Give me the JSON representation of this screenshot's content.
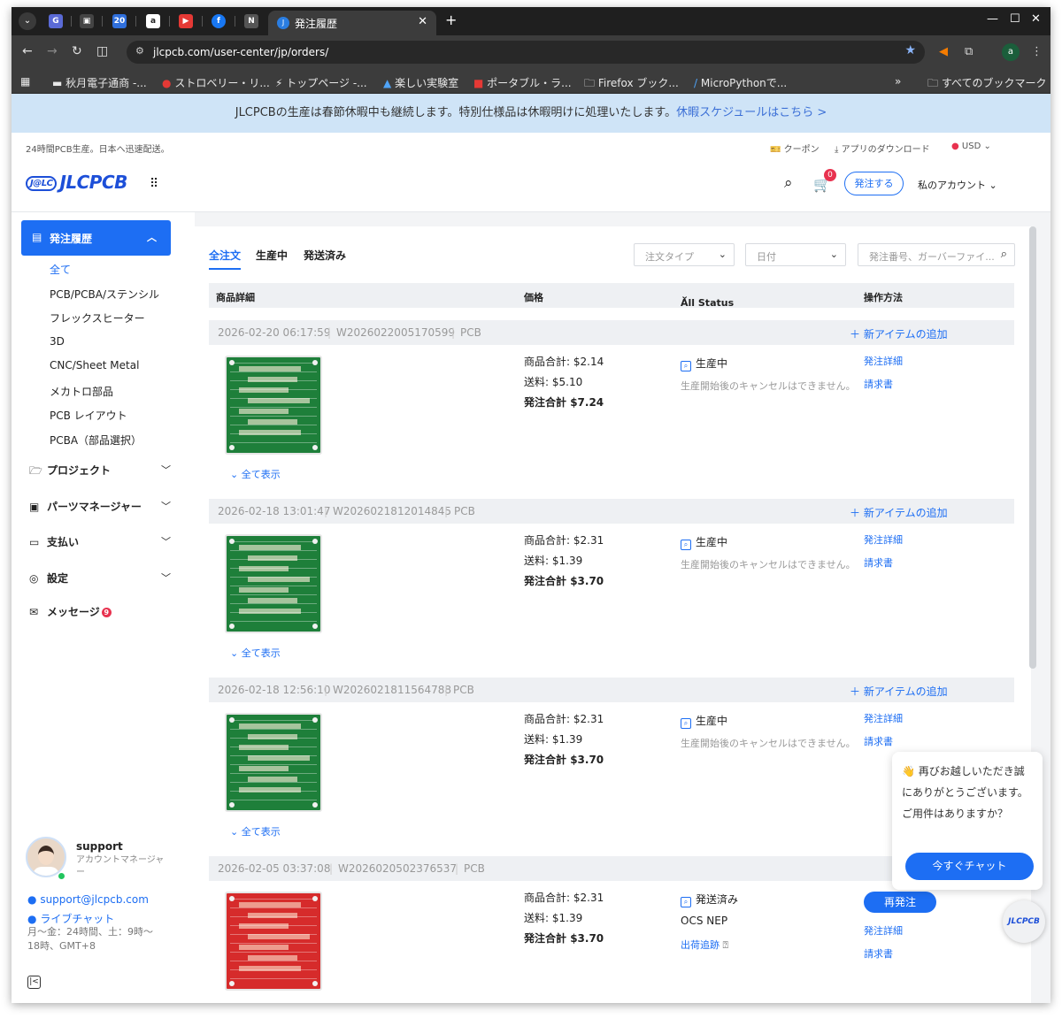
{
  "browser": {
    "tab_title": "発注履歴",
    "url": "jlcpcb.com/user-center/jp/orders/",
    "pinned_tabs": [
      {
        "name": "gemini-tab",
        "label": "G",
        "color": "#5a6ad6"
      },
      {
        "name": "box-tab",
        "label": "▣",
        "color": "#444"
      },
      {
        "name": "calendar-tab",
        "label": "20",
        "color": "#2f6fdc"
      },
      {
        "name": "amazon-tab",
        "label": "a",
        "color": "#222"
      },
      {
        "name": "youtube-tab",
        "label": "▶",
        "color": "#e53935"
      },
      {
        "name": "facebook-tab",
        "label": "f",
        "color": "#1877f2"
      },
      {
        "name": "notion-tab",
        "label": "N",
        "color": "#555"
      }
    ],
    "bookmarks": [
      "秋月電子通商 -...",
      "ストロベリー・リ...",
      "トップページ -...",
      "楽しい実験室",
      "ポータブル・ラ...",
      "Firefox ブック...",
      "MicroPythonで...",
      "すべてのブックマーク"
    ],
    "profile_initial": "a"
  },
  "banner": {
    "text": "JLCPCBの生産は春節休暇中も継続します。特別仕様品は休暇明けに処理いたします。",
    "link": "休暇スケジュールはこちら >"
  },
  "header": {
    "tagline": "24時間PCB生産。日本へ迅速配送。",
    "coupon": "クーポン",
    "app_download": "アプリのダウンロード",
    "currency": "USD",
    "logo_badge": "J@LC",
    "logo_text": "JLCPCB",
    "cart_count": "0",
    "order_button": "発注する",
    "account": "私のアカウント"
  },
  "sidebar": {
    "active": "発注履歴",
    "sub_items": [
      "全て",
      "PCB/PCBA/ステンシル",
      "フレックスヒーター",
      "3D",
      "CNC/Sheet Metal",
      "メカトロ部品",
      "PCB レイアウト",
      "PCBA（部品選択）"
    ],
    "sections": [
      "プロジェクト",
      "パーツマネージャー",
      "支払い",
      "設定"
    ],
    "messages": "メッセージ",
    "message_count": "9",
    "support": {
      "name": "support",
      "role": "アカウントマネージャー",
      "email": "support@jlcpcb.com",
      "live_chat": "ライブチャット",
      "hours": "月～金：24時間、土：9時～18時、GMT+8"
    }
  },
  "main": {
    "tabs": [
      "全注文",
      "生産中",
      "発送済み"
    ],
    "filters": {
      "order_type": "注文タイプ",
      "date": "日付",
      "search_placeholder": "発注番号、ガーバーファイ..."
    },
    "columns": [
      "商品詳細",
      "価格",
      "All Status",
      "操作方法"
    ],
    "add_item": "＋ 新アイテムの追加",
    "show_all": "全て表示",
    "labels": {
      "subtotal": "商品合計:",
      "shipping": "送料:",
      "total": "発注合計"
    },
    "orders": [
      {
        "date": "2026-02-20 06:17:59",
        "id": "W2026022005170599",
        "type": "PCB",
        "subtotal": "$2.14",
        "shipping": "$5.10",
        "total": "$7.24",
        "status": "生産中",
        "note": "生産開始後のキャンセルはできません。",
        "actions": [
          "発注詳細",
          "請求書"
        ],
        "board_color": "green"
      },
      {
        "date": "2026-02-18 13:01:47",
        "id": "W2026021812014845",
        "type": "PCB",
        "subtotal": "$2.31",
        "shipping": "$1.39",
        "total": "$3.70",
        "status": "生産中",
        "note": "生産開始後のキャンセルはできません。",
        "actions": [
          "発注詳細",
          "請求書"
        ],
        "board_color": "green"
      },
      {
        "date": "2026-02-18 12:56:10",
        "id": "W2026021811564788",
        "type": "PCB",
        "subtotal": "$2.31",
        "shipping": "$1.39",
        "total": "$3.70",
        "status": "生産中",
        "note": "生産開始後のキャンセルはできません。",
        "actions": [
          "発注詳細",
          "請求書"
        ],
        "board_color": "green"
      },
      {
        "date": "2026-02-05 03:37:08",
        "id": "W2026020502376537",
        "type": "PCB",
        "subtotal": "$2.31",
        "shipping": "$1.39",
        "total": "$3.70",
        "status": "発送済み",
        "carrier": "OCS NEP",
        "tracking": "出荷追跡",
        "reorder": "再発注",
        "actions": [
          "発注詳細",
          "請求書"
        ],
        "board_color": "red"
      }
    ]
  },
  "chat": {
    "message": "👋 再びお越しいただき誠にありがとうございます。ご用件はありますか？",
    "button": "今すぐチャット",
    "fab_label": "JLCPCB"
  }
}
